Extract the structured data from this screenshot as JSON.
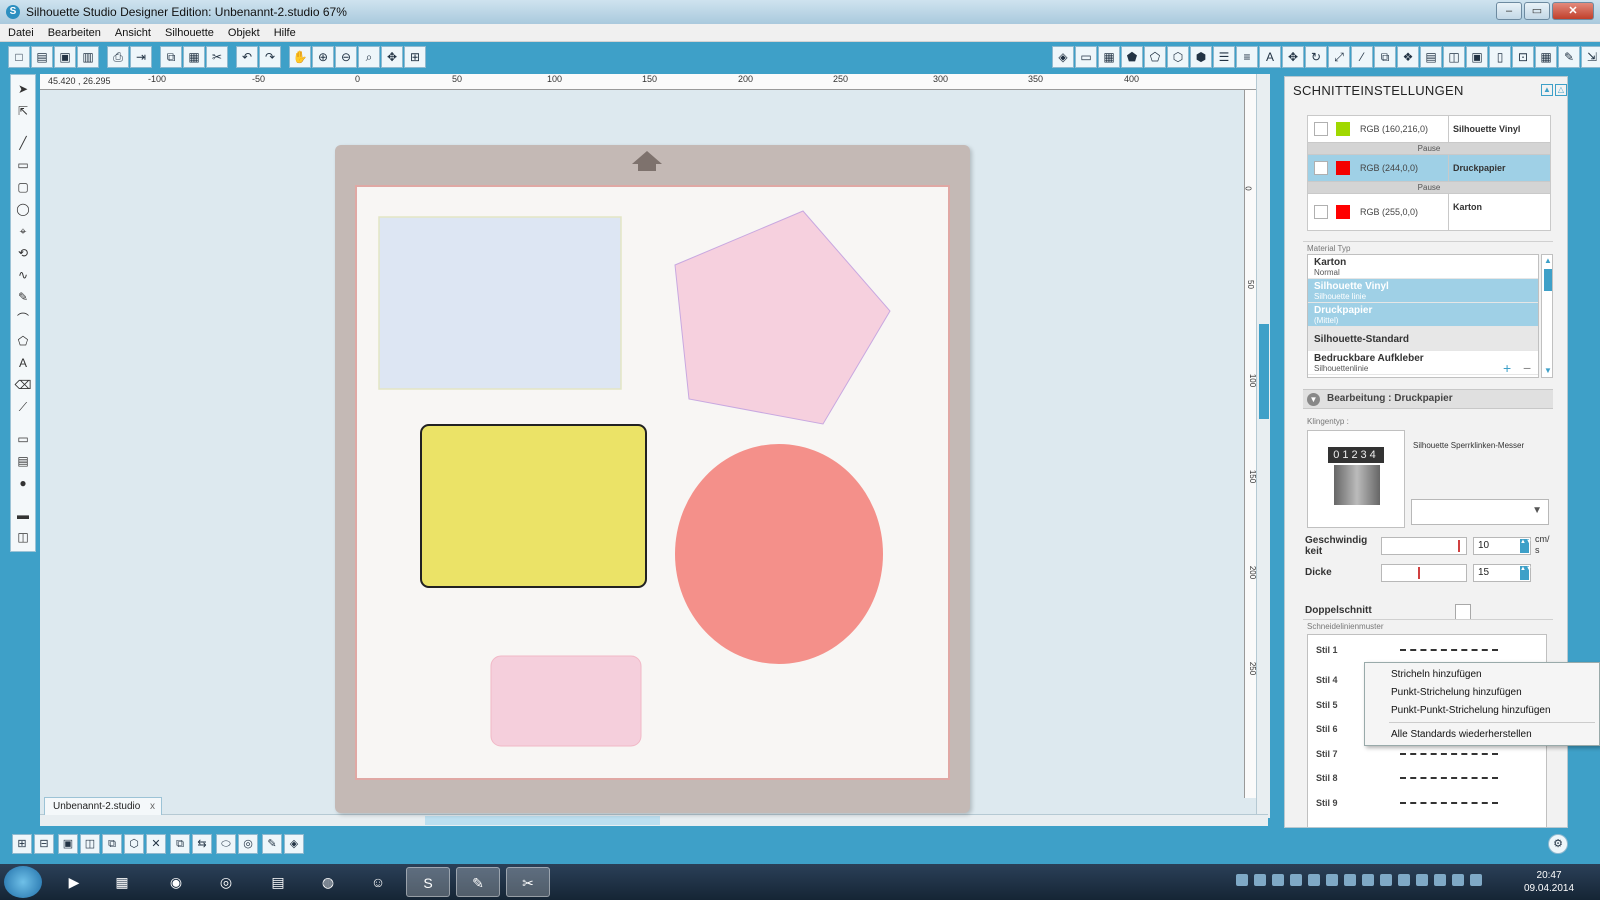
{
  "window": {
    "title": "Silhouette Studio Designer Edition: Unbenannt-2.studio 67%"
  },
  "menu": [
    "Datei",
    "Bearbeiten",
    "Ansicht",
    "Silhouette",
    "Objekt",
    "Hilfe"
  ],
  "ruler": {
    "coord": "45.420 , 26.295",
    "top_labels": [
      "-100",
      "-50",
      "0",
      "50",
      "100",
      "150",
      "200",
      "250",
      "300",
      "350",
      "400"
    ],
    "left_labels": [
      "0",
      "50",
      "100",
      "150",
      "200",
      "250"
    ]
  },
  "document_tab": {
    "label": "Unbenannt-2.studio",
    "close": "x"
  },
  "shapes": [
    {
      "type": "rect",
      "fill": "#dde6f3",
      "stroke": "#e3e5c4"
    },
    {
      "type": "pentagon",
      "fill": "#f6d0de",
      "stroke": "#c8a8e0"
    },
    {
      "type": "rounded-rect",
      "fill": "#ebe367",
      "stroke": "#222222"
    },
    {
      "type": "circle",
      "fill": "#f4908a",
      "stroke": "none"
    },
    {
      "type": "rounded-rect",
      "fill": "#f5cfdc",
      "stroke": "#f1b8c6"
    }
  ],
  "panel": {
    "title": "SCHNITTEINSTELLUNGEN",
    "colors": [
      {
        "rgb": "RGB (160,216,0)",
        "swatch": "#a0d800",
        "material": "Silhouette Vinyl",
        "selected": false
      },
      {
        "rgb": "RGB (244,0,0)",
        "swatch": "#f40000",
        "material": "Druckpapier",
        "selected": true
      },
      {
        "rgb": "RGB (255,0,0)",
        "swatch": "#ff0000",
        "material": "Karton",
        "selected": false
      }
    ],
    "pause_label": "Pause",
    "material_type_label": "Material Typ",
    "materials": [
      {
        "name": "Karton",
        "sub": "Normal",
        "selected": false
      },
      {
        "name": "Silhouette Vinyl",
        "sub": "Silhouette linie",
        "selected": true
      },
      {
        "name": "Druckpapier",
        "sub": "(Mittel)",
        "selected": true
      },
      {
        "name": "Silhouette-Standard",
        "sub": "",
        "selected": false
      },
      {
        "name": "Bedruckbare Aufkleber",
        "sub": "Silhouettenlinie",
        "selected": false
      }
    ],
    "bearbeitung_label": "Bearbeitung : Druckpapier",
    "klingentyp_label": "Klingentyp :",
    "blade_numbers": "01234",
    "blade_name": "Silhouette Sperrklinken-Messer",
    "speed_label": "Geschwindig keit",
    "speed_value": "10",
    "speed_unit": "cm/ s",
    "speed_level": 0.95,
    "thickness_label": "Dicke",
    "thickness_value": "15",
    "thickness_level": 0.45,
    "double_cut_label": "Doppelschnitt",
    "pattern_label": "Schneidelinienmuster",
    "styles": [
      "Stil 1",
      "Stil 4",
      "Stil 5",
      "Stil 6",
      "Stil 7",
      "Stil 8",
      "Stil 9"
    ]
  },
  "context_menu": {
    "items": [
      "Stricheln hinzufügen",
      "Punkt-Strichelung hinzufügen",
      "Punkt-Punkt-Strichelung hinzufügen"
    ],
    "reset": "Alle Standards wiederherstellen"
  },
  "taskbar": {
    "time": "20:47",
    "date": "09.04.2014"
  },
  "colors": {
    "accent": "#3ea0c8",
    "mat": "#c4b9b5"
  }
}
